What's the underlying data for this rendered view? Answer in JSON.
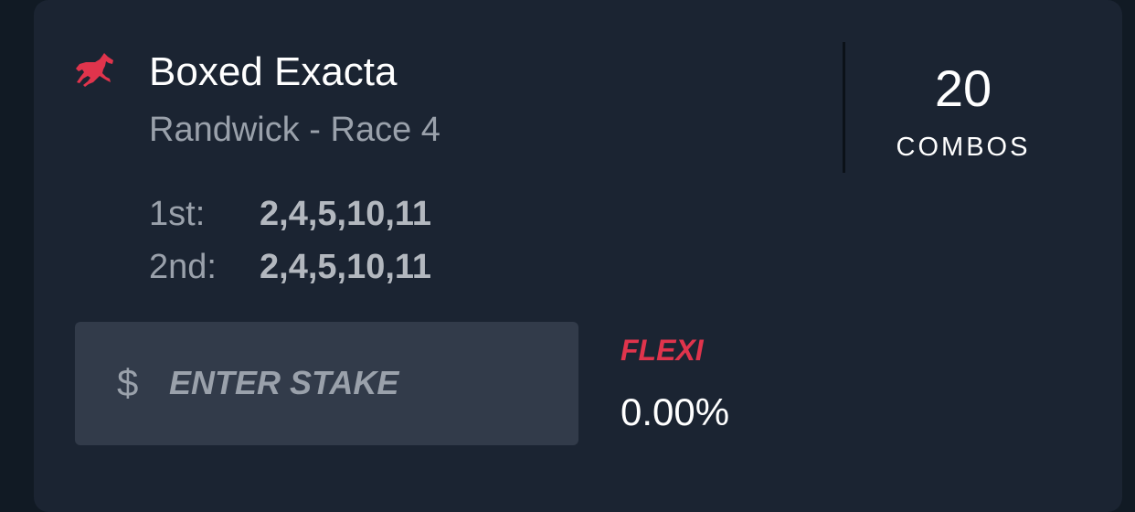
{
  "bet": {
    "icon": "horse-icon",
    "title": "Boxed Exacta",
    "race": "Randwick - Race 4",
    "combos": {
      "count": "20",
      "label": "COMBOS"
    },
    "selections": [
      {
        "label": "1st:",
        "value": "2,4,5,10,11"
      },
      {
        "label": "2nd:",
        "value": "2,4,5,10,11"
      }
    ]
  },
  "stake": {
    "currency_symbol": "$",
    "value": "",
    "placeholder": "ENTER STAKE"
  },
  "flexi": {
    "label": "FLEXI",
    "value": "0.00%"
  },
  "colors": {
    "background": "#111a24",
    "card": "#1b2432",
    "accent": "#e0344c",
    "input_bg": "#323b4a",
    "muted_text": "#9aa1ab"
  }
}
